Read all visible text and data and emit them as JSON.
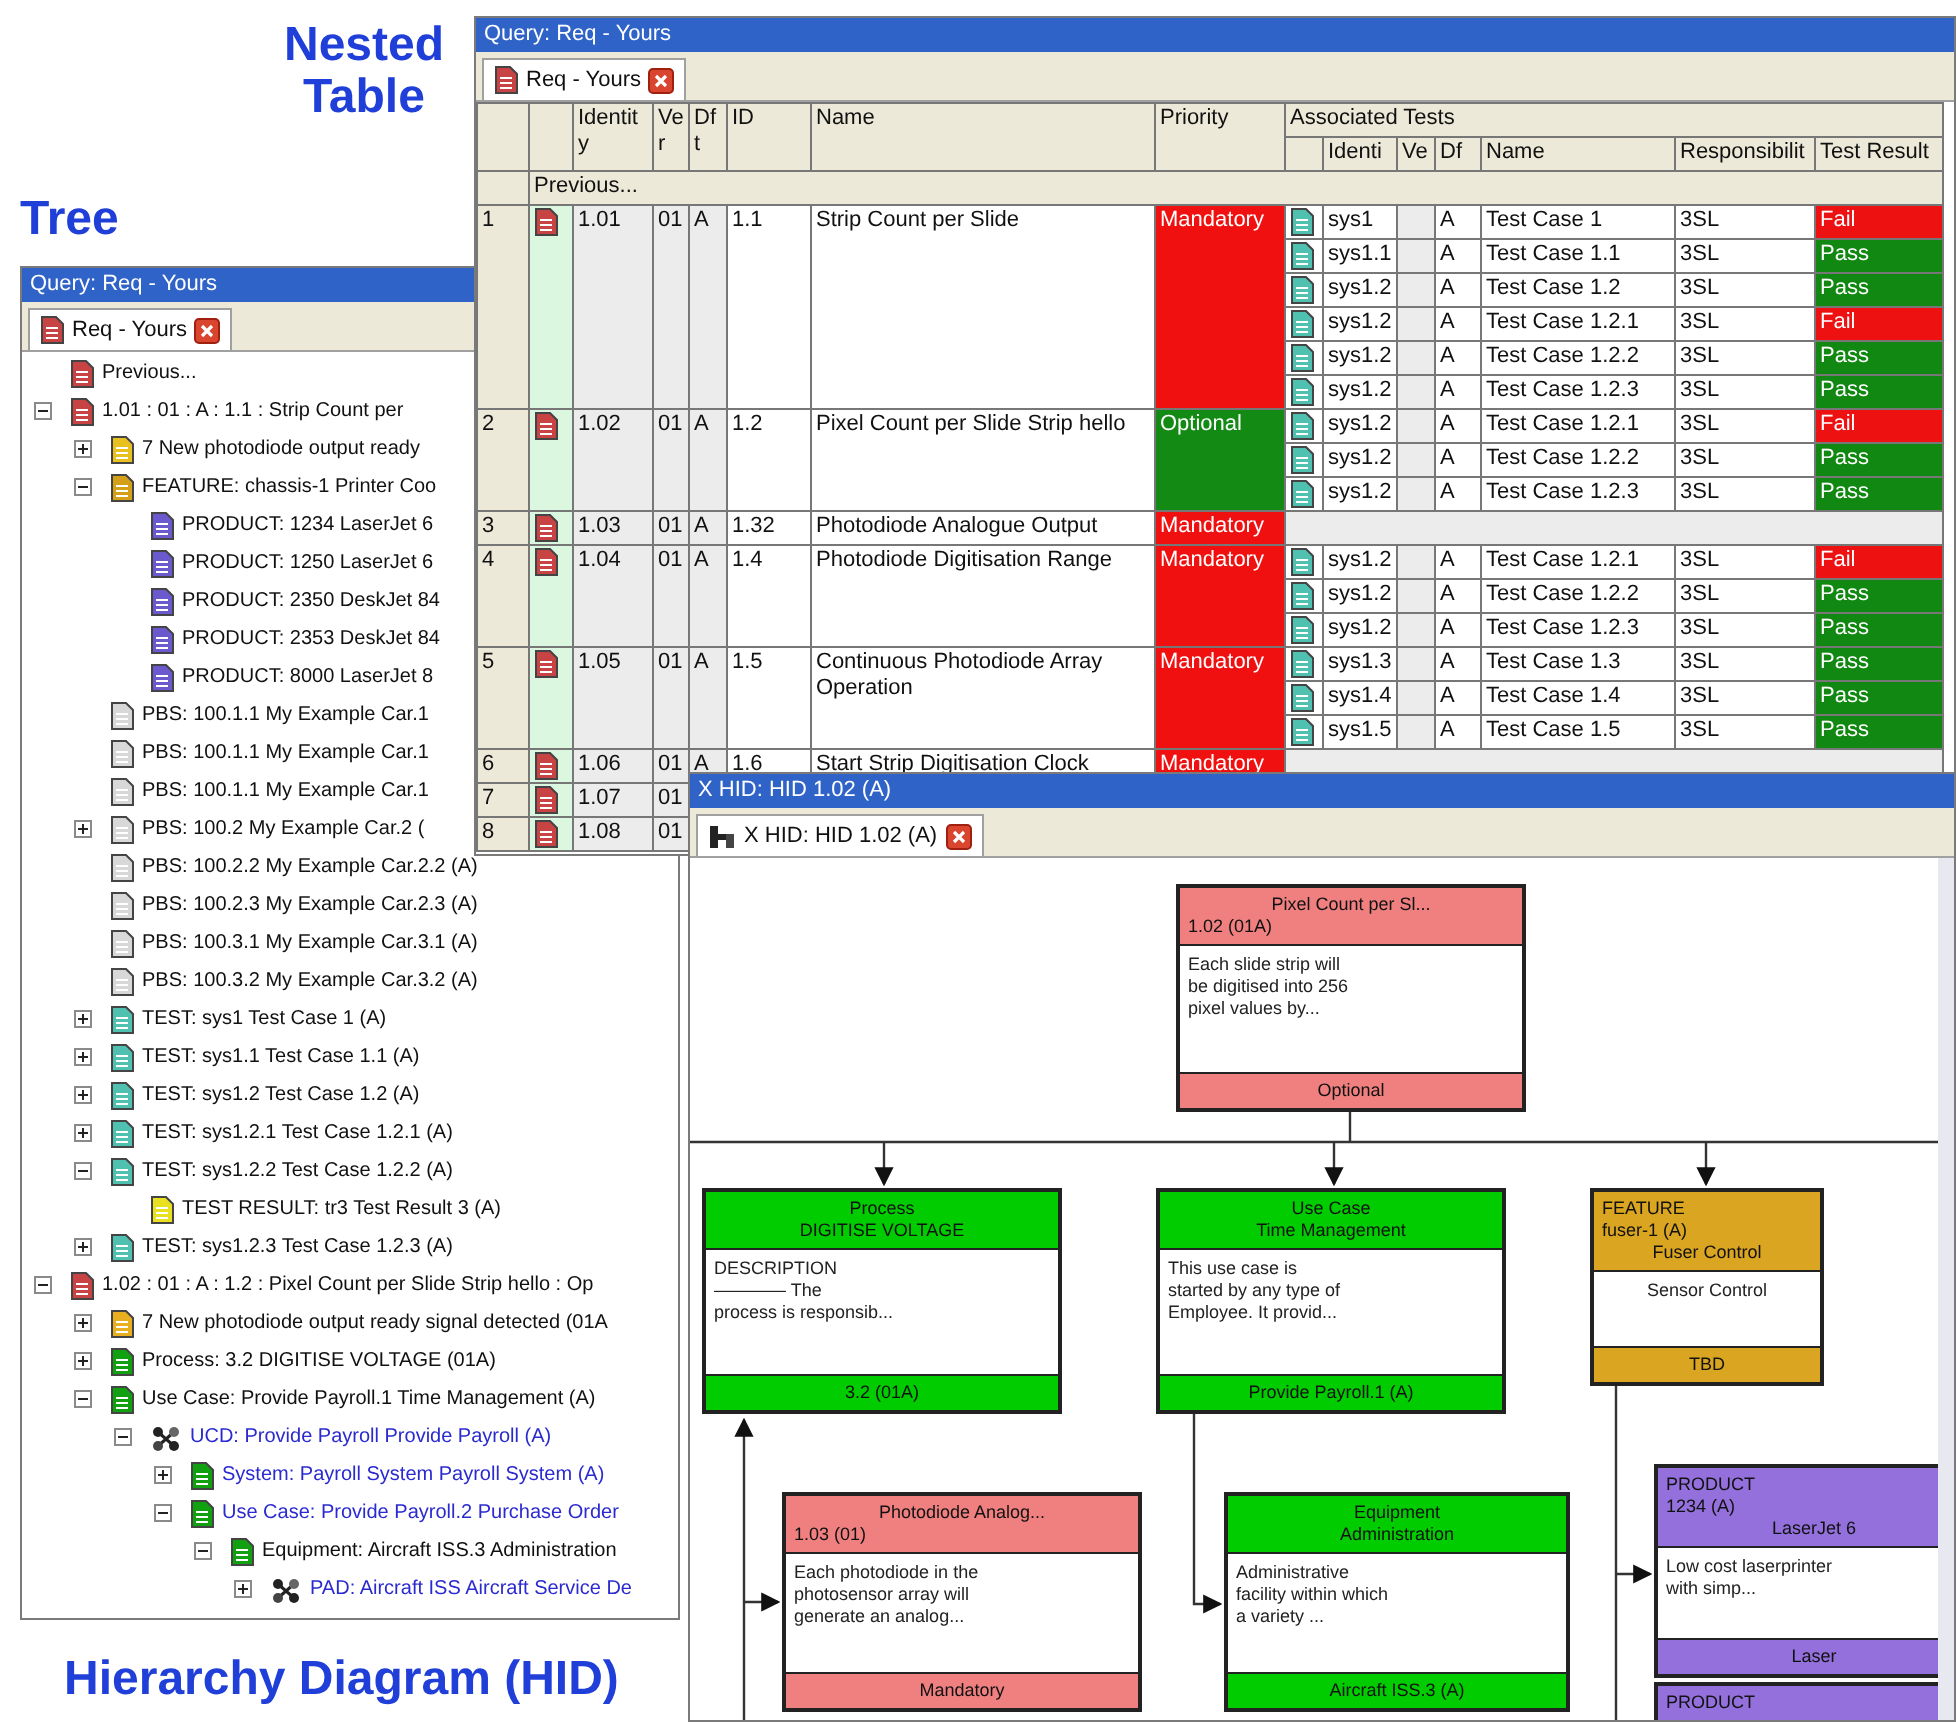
{
  "headings": [
    "Nested Table",
    "Tree",
    "Hierarchy Diagram (HID)"
  ],
  "tree_window": {
    "title": "Query: Req - Yours",
    "tab": "Req - Yours",
    "tree": [
      {
        "label": "Previous...",
        "color": "#c84444",
        "kind": "document"
      },
      {
        "label": "1.01 : 01 : A : 1.1 : Strip Count per",
        "color": "#c84444",
        "kind": "document",
        "expanded": true,
        "children": [
          {
            "label": "7 New photodiode output ready",
            "color": "#e8c020",
            "kind": "document",
            "expanded": false
          },
          {
            "label": "FEATURE: chassis-1 Printer Coo",
            "color": "#d4a017",
            "kind": "document",
            "expanded": true,
            "children": [
              {
                "label": "PRODUCT: 1234 LaserJet 6",
                "color": "#6a5acd",
                "kind": "document"
              },
              {
                "label": "PRODUCT: 1250 LaserJet 6",
                "color": "#6a5acd",
                "kind": "document"
              },
              {
                "label": "PRODUCT: 2350 DeskJet 84",
                "color": "#6a5acd",
                "kind": "document"
              },
              {
                "label": "PRODUCT: 2353 DeskJet 84",
                "color": "#6a5acd",
                "kind": "document"
              },
              {
                "label": "PRODUCT: 8000 LaserJet 8",
                "color": "#6a5acd",
                "kind": "document"
              }
            ]
          },
          {
            "label": "PBS: 100.1.1 My Example Car.1",
            "color": "#d8d8d8",
            "kind": "document"
          },
          {
            "label": "PBS: 100.1.1 My Example Car.1",
            "color": "#d8d8d8",
            "kind": "document"
          },
          {
            "label": "PBS: 100.1.1 My Example Car.1",
            "color": "#d8d8d8",
            "kind": "document"
          },
          {
            "label": "PBS: 100.2 My Example Car.2 (",
            "color": "#d8d8d8",
            "kind": "document",
            "expanded": false
          },
          {
            "label": "PBS: 100.2.2 My Example Car.2.2 (A)",
            "color": "#d8d8d8",
            "kind": "document"
          },
          {
            "label": "PBS: 100.2.3 My Example Car.2.3 (A)",
            "color": "#d8d8d8",
            "kind": "document"
          },
          {
            "label": "PBS: 100.3.1 My Example Car.3.1 (A)",
            "color": "#d8d8d8",
            "kind": "document"
          },
          {
            "label": "PBS: 100.3.2 My Example Car.3.2 (A)",
            "color": "#d8d8d8",
            "kind": "document"
          },
          {
            "label": "TEST: sys1  Test Case 1 (A)",
            "color": "#50c0b0",
            "kind": "document",
            "expanded": false
          },
          {
            "label": "TEST: sys1.1  Test Case 1.1 (A)",
            "color": "#50c0b0",
            "kind": "document",
            "expanded": false
          },
          {
            "label": "TEST: sys1.2  Test Case 1.2 (A)",
            "color": "#50c0b0",
            "kind": "document",
            "expanded": false
          },
          {
            "label": "TEST: sys1.2.1  Test Case 1.2.1 (A)",
            "color": "#50c0b0",
            "kind": "document",
            "expanded": false
          },
          {
            "label": "TEST: sys1.2.2  Test Case 1.2.2 (A)",
            "color": "#50c0b0",
            "kind": "document",
            "expanded": true,
            "children": [
              {
                "label": "TEST RESULT: tr3  Test Result 3 (A)",
                "color": "#e8e020",
                "kind": "document"
              }
            ]
          },
          {
            "label": "TEST: sys1.2.3  Test Case 1.2.3 (A)",
            "color": "#50c0b0",
            "kind": "document",
            "expanded": false
          }
        ]
      },
      {
        "label": "1.02 : 01 : A : 1.2 : Pixel Count per Slide Strip hello : Op",
        "color": "#c84444",
        "kind": "document",
        "expanded": true,
        "children": [
          {
            "label": "7 New photodiode output ready signal detected (01A",
            "color": "#e8b020",
            "kind": "document",
            "expanded": false
          },
          {
            "label": "Process: 3.2 DIGITISE VOLTAGE (01A)",
            "color": "#10a010",
            "kind": "document",
            "expanded": false
          },
          {
            "label": "Use Case: Provide Payroll.1 Time Management (A)",
            "color": "#10a010",
            "kind": "document",
            "expanded": true,
            "children": [
              {
                "label": "UCD: Provide Payroll Provide Payroll (A)",
                "kind": "diagram",
                "linked": true,
                "expanded": true,
                "children": [
                  {
                    "label": "System: Payroll System Payroll System (A)",
                    "color": "#10a010",
                    "kind": "document",
                    "linked": true,
                    "expanded": false
                  },
                  {
                    "label": "Use Case: Provide Payroll.2 Purchase Order",
                    "color": "#10a010",
                    "kind": "document",
                    "linked": true,
                    "expanded": true,
                    "children": [
                      {
                        "label": "Equipment: Aircraft ISS.3 Administration",
                        "color": "#10a010",
                        "kind": "document",
                        "expanded": true,
                        "children": [
                          {
                            "label": "PAD: Aircraft ISS Aircraft Service De",
                            "kind": "diagram",
                            "linked": true,
                            "expanded": false
                          }
                        ]
                      }
                    ]
                  }
                ]
              }
            ]
          }
        ]
      }
    ]
  },
  "table_window": {
    "title": "Query: Req - Yours",
    "tab": "Req - Yours",
    "columns": [
      "Identity",
      "Ver",
      "Dft",
      "ID",
      "Name",
      "Priority"
    ],
    "group_heading": "Associated Tests",
    "test_columns": [
      "Identi",
      "Ve",
      "Df",
      "Name",
      "Responsibilit",
      "Test Result"
    ],
    "previous": "Previous...",
    "rows": [
      {
        "number": "1",
        "identity": "1.01",
        "version": "01",
        "draft": "A",
        "id": "1.1",
        "name": "Strip Count per Slide",
        "priority": "Mandatory",
        "mandatory": true,
        "tests": [
          {
            "id": "sys1",
            "draft": "A",
            "name": "Test Case 1",
            "responsibility": "3SL",
            "result": "Fail",
            "passed": false
          },
          {
            "id": "sys1.1",
            "draft": "A",
            "name": "Test Case 1.1",
            "responsibility": "3SL",
            "result": "Pass",
            "passed": true
          },
          {
            "id": "sys1.2",
            "draft": "A",
            "name": "Test Case 1.2",
            "responsibility": "3SL",
            "result": "Pass",
            "passed": true
          },
          {
            "id": "sys1.2",
            "draft": "A",
            "name": "Test Case 1.2.1",
            "responsibility": "3SL",
            "result": "Fail",
            "passed": false
          },
          {
            "id": "sys1.2",
            "draft": "A",
            "name": "Test Case 1.2.2",
            "responsibility": "3SL",
            "result": "Pass",
            "passed": true
          },
          {
            "id": "sys1.2",
            "draft": "A",
            "name": "Test Case 1.2.3",
            "responsibility": "3SL",
            "result": "Pass",
            "passed": true
          }
        ]
      },
      {
        "number": "2",
        "identity": "1.02",
        "version": "01",
        "draft": "A",
        "id": "1.2",
        "name": "Pixel Count per Slide Strip hello",
        "priority": "Optional",
        "mandatory": false,
        "tests": [
          {
            "id": "sys1.2",
            "draft": "A",
            "name": "Test Case 1.2.1",
            "responsibility": "3SL",
            "result": "Fail",
            "passed": false
          },
          {
            "id": "sys1.2",
            "draft": "A",
            "name": "Test Case 1.2.2",
            "responsibility": "3SL",
            "result": "Pass",
            "passed": true
          },
          {
            "id": "sys1.2",
            "draft": "A",
            "name": "Test Case 1.2.3",
            "responsibility": "3SL",
            "result": "Pass",
            "passed": true
          }
        ]
      },
      {
        "number": "3",
        "identity": "1.03",
        "version": "01",
        "draft": "A",
        "id": "1.32",
        "name": "Photodiode Analogue Output",
        "priority": "Mandatory",
        "mandatory": true
      },
      {
        "number": "4",
        "identity": "1.04",
        "version": "01",
        "draft": "A",
        "id": "1.4",
        "name": "Photodiode Digitisation Range",
        "priority": "Mandatory",
        "mandatory": true,
        "tests": [
          {
            "id": "sys1.2",
            "draft": "A",
            "name": "Test Case 1.2.1",
            "responsibility": "3SL",
            "result": "Fail",
            "passed": false
          },
          {
            "id": "sys1.2",
            "draft": "A",
            "name": "Test Case 1.2.2",
            "responsibility": "3SL",
            "result": "Pass",
            "passed": true
          },
          {
            "id": "sys1.2",
            "draft": "A",
            "name": "Test Case 1.2.3",
            "responsibility": "3SL",
            "result": "Pass",
            "passed": true
          }
        ]
      },
      {
        "number": "5",
        "identity": "1.05",
        "version": "01",
        "draft": "A",
        "id": "1.5",
        "name": "Continuous Photodiode Array Operation",
        "priority": "Mandatory",
        "mandatory": true,
        "tests": [
          {
            "id": "sys1.3",
            "draft": "A",
            "name": "Test Case 1.3",
            "responsibility": "3SL",
            "result": "Pass",
            "passed": true
          },
          {
            "id": "sys1.4",
            "draft": "A",
            "name": "Test Case 1.4",
            "responsibility": "3SL",
            "result": "Pass",
            "passed": true
          },
          {
            "id": "sys1.5",
            "draft": "A",
            "name": "Test Case 1.5",
            "responsibility": "3SL",
            "result": "Pass",
            "passed": true
          }
        ]
      },
      {
        "number": "6",
        "identity": "1.06",
        "version": "01",
        "draft": "A",
        "id": "1.6",
        "name": "Start Strip Digitisation Clock",
        "priority": "Mandatory",
        "mandatory": true
      },
      {
        "number": "7",
        "identity": "1.07",
        "version": "01"
      },
      {
        "number": "8",
        "identity": "1.08",
        "version": "01"
      }
    ]
  },
  "hid_window": {
    "title": "X HID: HID 1.02 (A)",
    "tab": "X HID: HID 1.02 (A)",
    "nodes": [
      {
        "kind": "requirement",
        "color": "#f08080",
        "title": "Pixel Count per Sl...",
        "id": "1.02 (01A)",
        "body": [
          "Each slide strip will",
          "be digitised into 256",
          "pixel values by..."
        ],
        "footer": "Optional"
      },
      {
        "kind": "element",
        "color": "#00cc00",
        "type": "Process",
        "title": "DIGITISE VOLTAGE",
        "body": [
          "DESCRIPTION",
          "———— The",
          "process is responsib..."
        ],
        "footer": "3.2 (01A)"
      },
      {
        "kind": "element",
        "color": "#00cc00",
        "type": "Use Case",
        "title": "Time Management",
        "body": [
          "This use case is",
          "started by any type of",
          "Employee. It provid..."
        ],
        "footer": "Provide Payroll.1 (A)"
      },
      {
        "kind": "item",
        "color": "#daa520",
        "type": "FEATURE",
        "id": "fuser-1 (A)",
        "title": "Fuser Control",
        "body": [
          "Sensor Control"
        ],
        "footer": "TBD"
      },
      {
        "kind": "requirement",
        "color": "#f08080",
        "title": "Photodiode Analog...",
        "id": "1.03 (01)",
        "body": [
          "Each photodiode in the",
          "photosensor array will",
          "generate an analog..."
        ],
        "footer": "Mandatory"
      },
      {
        "kind": "element",
        "color": "#00cc00",
        "type": "Equipment",
        "title": "Administration",
        "body": [
          "Administrative",
          "facility within which",
          "a variety ..."
        ],
        "footer": "Aircraft ISS.3 (A)"
      },
      {
        "kind": "item",
        "color": "#9370db",
        "type": "PRODUCT",
        "id": "1234 (A)",
        "title": "LaserJet 6",
        "body": [
          "Low cost laserprinter",
          "with simp..."
        ],
        "footer": "Laser"
      },
      {
        "kind": "item",
        "color": "#9370db",
        "type": "PRODUCT"
      }
    ]
  }
}
